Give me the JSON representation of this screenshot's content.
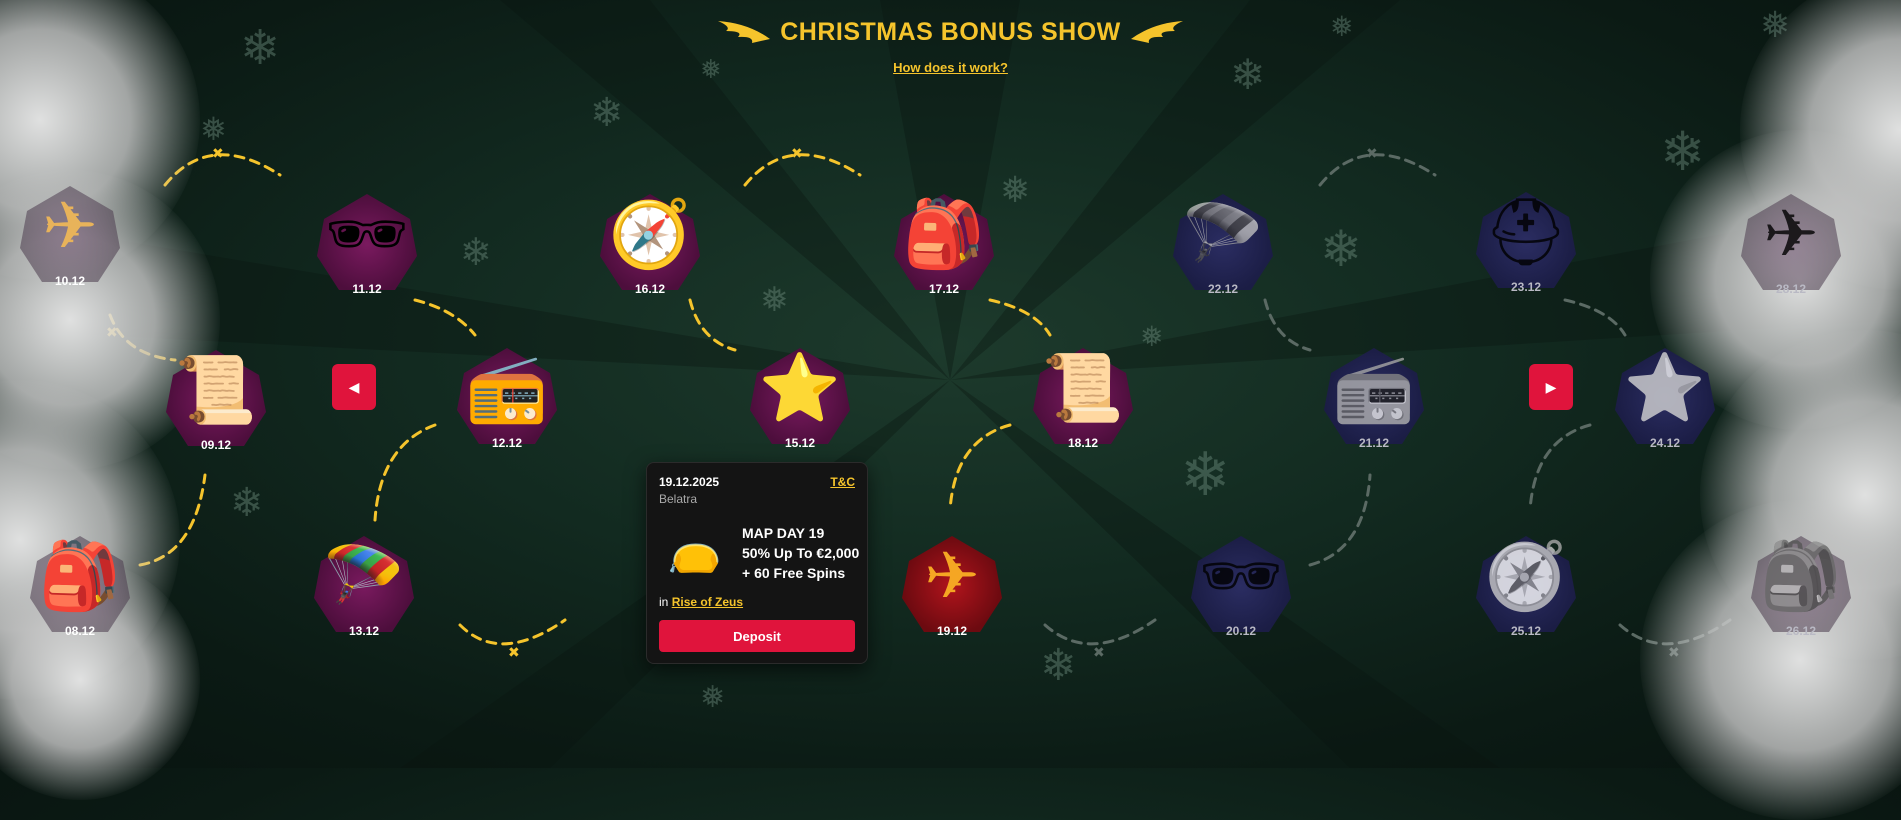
{
  "header": {
    "title": "CHRISTMAS BONUS SHOW",
    "how_link": "How does it work?"
  },
  "nodes": [
    {
      "date": "10.12",
      "icon_name": "biplane-icon",
      "glyph": "✈",
      "state": "faded"
    },
    {
      "date": "11.12",
      "icon_name": "aviator-sunglasses-icon",
      "glyph": "🕶",
      "state": "active"
    },
    {
      "date": "16.12",
      "icon_name": "compass-icon",
      "glyph": "🧭",
      "state": "active"
    },
    {
      "date": "17.12",
      "icon_name": "backpack-icon",
      "glyph": "🎒",
      "state": "active"
    },
    {
      "date": "22.12",
      "icon_name": "parachute-crate-icon",
      "glyph": "🪂",
      "state": "locked"
    },
    {
      "date": "23.12",
      "icon_name": "pilot-helmet-icon",
      "glyph": "⛑",
      "state": "locked"
    },
    {
      "date": "28.12",
      "icon_name": "biplane-icon",
      "glyph": "✈",
      "state": "faded"
    },
    {
      "date": "09.12",
      "icon_name": "map-scroll-icon",
      "glyph": "📜",
      "state": "active"
    },
    {
      "date": "12.12",
      "icon_name": "radio-transmitter-icon",
      "glyph": "📻",
      "state": "active"
    },
    {
      "date": "15.12",
      "icon_name": "winged-star-badge-icon",
      "glyph": "⭐",
      "state": "active"
    },
    {
      "date": "18.12",
      "icon_name": "map-scroll-icon",
      "glyph": "📜",
      "state": "active"
    },
    {
      "date": "21.12",
      "icon_name": "radio-transmitter-icon",
      "glyph": "📻",
      "state": "locked"
    },
    {
      "date": "24.12",
      "icon_name": "winged-star-badge-icon",
      "glyph": "⭐",
      "state": "locked"
    },
    {
      "date": "08.12",
      "icon_name": "backpack-icon",
      "glyph": "🎒",
      "state": "faded"
    },
    {
      "date": "13.12",
      "icon_name": "parachute-crate-icon",
      "glyph": "🪂",
      "state": "active"
    },
    {
      "date": "19.12",
      "icon_name": "biplane-icon",
      "glyph": "✈",
      "state": "current"
    },
    {
      "date": "20.12",
      "icon_name": "aviator-sunglasses-icon",
      "glyph": "🕶",
      "state": "locked"
    },
    {
      "date": "25.12",
      "icon_name": "compass-icon",
      "glyph": "🧭",
      "state": "locked"
    },
    {
      "date": "26.12",
      "icon_name": "backpack-icon",
      "glyph": "🎒",
      "state": "faded"
    }
  ],
  "popup": {
    "date": "19.12.2025",
    "provider": "Belatra",
    "tc_link": "T&C",
    "offer_line1": "MAP DAY 19",
    "offer_line2": "50% Up To €2,000",
    "offer_line3": "+ 60 Free Spins",
    "in_label": "in",
    "game": "Rise of Zeus",
    "deposit_label": "Deposit"
  },
  "colors": {
    "accent_gold": "#f5c42c",
    "accent_red": "#e0143c",
    "background": "#0b1a14"
  }
}
